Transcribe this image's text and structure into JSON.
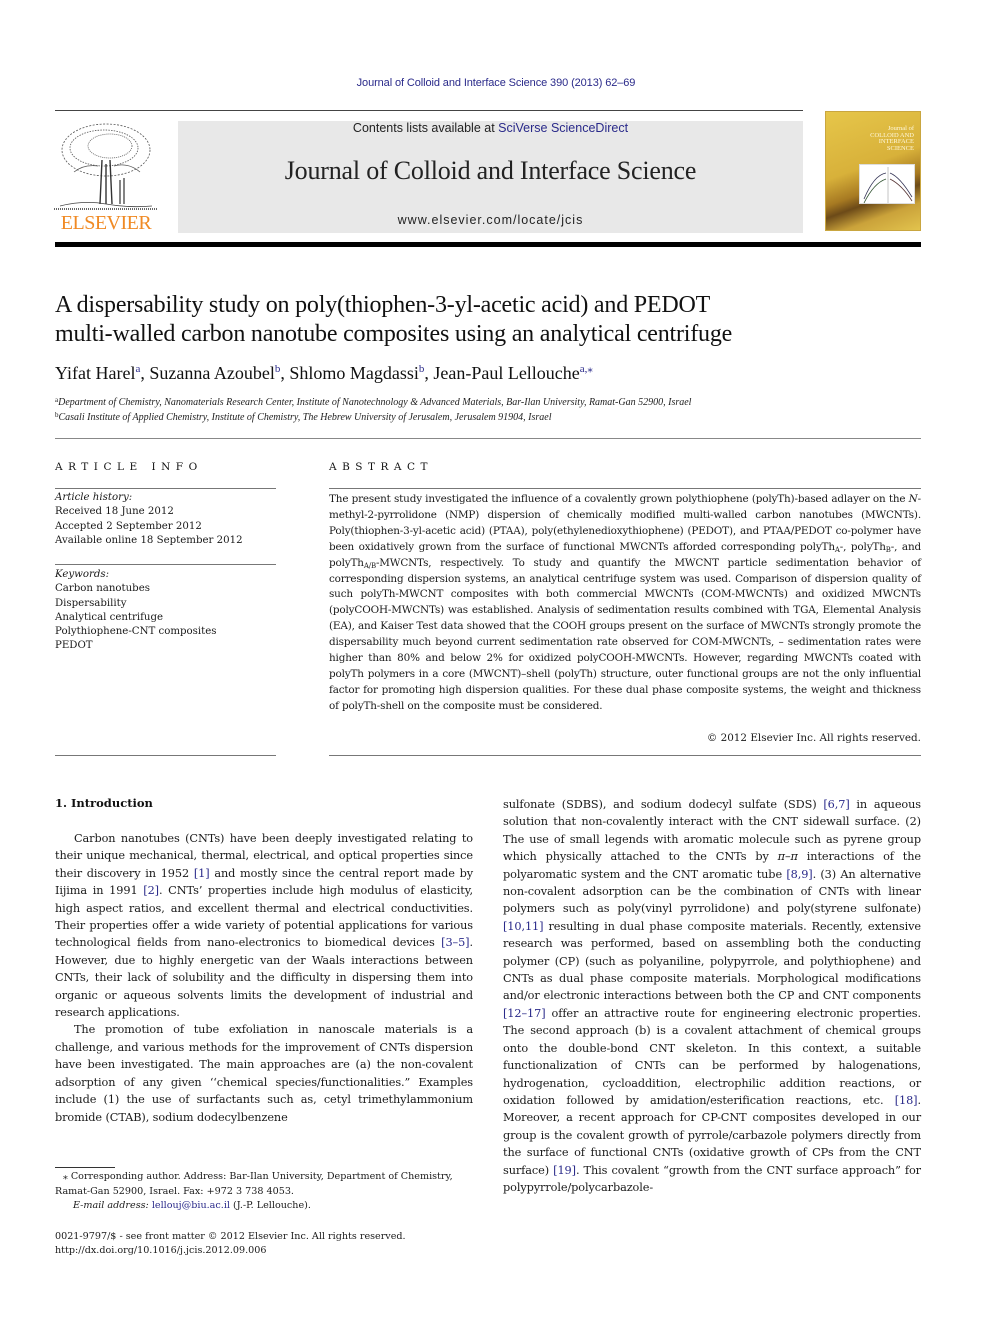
{
  "header": {
    "journal_citation": "Journal of Colloid and Interface Science 390 (2013) 62–69",
    "contents_prefix": "Contents lists available at ",
    "contents_link": "SciVerse ScienceDirect",
    "journal_name": "Journal of Colloid and Interface Science",
    "journal_url": "www.elsevier.com/locate/jcis",
    "publisher_logo_text": "ELSEVIER",
    "cover_title": [
      "Journal of",
      "COLLOID AND",
      "INTERFACE",
      "SCIENCE"
    ]
  },
  "colors": {
    "link": "#2a2a8a",
    "elsevier_orange": "#f08a24",
    "header_box": "#e8e8e8",
    "cover_gold": "#d8b13a"
  },
  "article": {
    "title_line1": "A dispersability study on poly(thiophen-3-yl-acetic acid) and PEDOT",
    "title_line2": "multi-walled carbon nanotube composites using an analytical centrifuge",
    "authors": [
      {
        "name": "Yifat Harel",
        "sup": "a"
      },
      {
        "name": "Suzanna Azoubel",
        "sup": "b"
      },
      {
        "name": "Shlomo Magdassi",
        "sup": "b"
      },
      {
        "name": "Jean-Paul Lellouche",
        "sup": "a,⁎"
      }
    ],
    "affiliations": [
      {
        "key": "a",
        "text": "Department of Chemistry, Nanomaterials Research Center, Institute of Nanotechnology & Advanced Materials, Bar-Ilan University, Ramat-Gan 52900, Israel"
      },
      {
        "key": "b",
        "text": "Casali Institute of Applied Chemistry, Institute of Chemistry, The Hebrew University of Jerusalem, Jerusalem 91904, Israel"
      }
    ]
  },
  "article_info": {
    "heading": "ARTICLE INFO",
    "history_label": "Article history:",
    "history": [
      "Received 18 June 2012",
      "Accepted 2 September 2012",
      "Available online 18 September 2012"
    ],
    "keywords_label": "Keywords:",
    "keywords": [
      "Carbon nanotubes",
      "Dispersability",
      "Analytical centrifuge",
      "Polythiophene-CNT composites",
      "PEDOT"
    ]
  },
  "abstract": {
    "heading": "ABSTRACT",
    "part1": "The present study investigated the influence of a covalently grown polythiophene (polyTh)-based adlayer on the ",
    "n_italic": "N",
    "part2": "-methyl-2-pyrrolidone (NMP) dispersion of chemically modified multi-walled carbon nanotubes (MWCNTs). Poly(thiophen-3-yl-acetic acid) (PTAA), poly(ethylenedioxythiophene) (PEDOT), and PTAA/PEDOT co-polymer have been oxidatively grown from the surface of functional MWCNTs afforded corresponding polyTh",
    "sub_a": "A",
    "part3": "-, polyTh",
    "sub_b": "B",
    "part4": "-, and polyTh",
    "sub_ab": "A/B",
    "part5": "-MWCNTs, respectively. To study and quantify the MWCNT particle sedimentation behavior of corresponding dispersion systems, an analytical centrifuge system was used. Comparison of dispersion quality of such polyTh-MWCNT composites with both commercial MWCNTs (COM-MWCNTs) and oxidized MWCNTs (polyCOOH-MWCNTs) was established. Analysis of sedimentation results combined with TGA, Elemental Analysis (EA), and Kaiser Test data showed that the COOH groups present on the surface of MWCNTs strongly promote the dispersability much beyond current sedimentation rate observed for COM-MWCNTs, – sedimentation rates were higher than 80% and below 2% for oxidized polyCOOH-MWCNTs. However, regarding MWCNTs coated with polyTh polymers in a core (MWCNT)–shell (polyTh) structure, outer functional groups are not the only influential factor for promoting high dispersion qualities. For these dual phase composite systems, the weight and thickness of polyTh-shell on the composite must be considered.",
    "copyright": "© 2012 Elsevier Inc. All rights reserved."
  },
  "introduction": {
    "heading": "1. Introduction",
    "p1_a": "Carbon nanotubes (CNTs) have been deeply investigated relating to their unique mechanical, thermal, electrical, and optical properties since their discovery in 1952 ",
    "p1_ref1": "[1]",
    "p1_b": " and mostly since the central report made by Iijima in 1991 ",
    "p1_ref2": "[2]",
    "p1_c": ". CNTs’ properties include high modulus of elasticity, high aspect ratios, and excellent thermal and electrical conductivities. Their properties offer a wide variety of potential applications for various technological fields from nano-electronics to biomedical devices ",
    "p1_ref3": "[3–5]",
    "p1_d": ". However, due to highly energetic van der Waals interactions between CNTs, their lack of solubility and the difficulty in dispersing them into organic or aqueous solvents limits the development of industrial and research applications.",
    "p2_a": "The promotion of tube exfoliation in nanoscale materials is a challenge, and various methods for the improvement of CNTs dispersion have been investigated. The main approaches are (a) the non-covalent adsorption of any given ‘‘chemical species/functionalities.” Examples include (1) the use of surfactants such as, cetyl trimethylammonium bromide (CTAB), sodium dodecylbenzene ",
    "r_a": "sulfonate (SDBS), and sodium dodecyl sulfate (SDS) ",
    "r_ref1": "[6,7]",
    "r_b": " in aqueous solution that non-covalently interact with the CNT sidewall surface. (2) The use of small legends with aromatic molecule such as pyrene group which physically attached to the CNTs by ",
    "r_pi": "π–π",
    "r_c": " interactions of the polyaromatic system and the CNT aromatic tube ",
    "r_ref2": "[8,9]",
    "r_d": ". (3) An alternative non-covalent adsorption can be the combination of CNTs with linear polymers such as poly(vinyl pyrrolidone) and poly(styrene sulfonate) ",
    "r_ref3": "[10,11]",
    "r_e": " resulting in dual phase composite materials. Recently, extensive research was performed, based on assembling both the conducting polymer (CP) (such as polyaniline, polypyrrole, and polythiophene) and CNTs as dual phase composite materials. Morphological modifications and/or electronic interactions between both the CP and CNT components ",
    "r_ref4": "[12–17]",
    "r_f": " offer an attractive route for engineering electronic properties. The second approach (b) is a covalent attachment of chemical groups onto the double-bond CNT skeleton. In this context, a suitable functionalization of CNTs can be performed by halogenations, hydrogenation, cycloaddition, electrophilic addition reactions, or oxidation followed by amidation/esterification reactions, etc. ",
    "r_ref5": "[18]",
    "r_g": ". Moreover, a recent approach for CP-CNT composites developed in our group is the covalent growth of pyrrole/carbazole polymers directly from the surface of functional CNTs (oxidative growth of CPs from the CNT surface) ",
    "r_ref6": "[19]",
    "r_h": ". This covalent “growth from the CNT surface approach” for polypyrrole/polycarbazole-"
  },
  "footnotes": {
    "corresponding": "⁎ Corresponding author. Address: Bar-Ilan University, Department of Chemistry, Ramat-Gan 52900, Israel. Fax: +972 3 738 4053.",
    "email_label": "E-mail address:",
    "email": "lellouj@biu.ac.il",
    "email_suffix": " (J.-P. Lellouche).",
    "issn": "0021-9797/$ - see front matter © 2012 Elsevier Inc. All rights reserved.",
    "doi": "http://dx.doi.org/10.1016/j.jcis.2012.09.006"
  }
}
